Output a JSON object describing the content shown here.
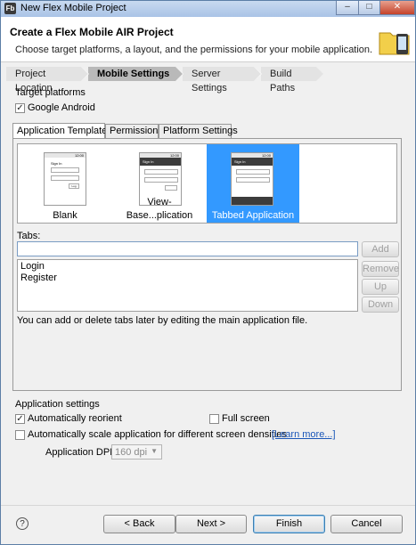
{
  "window": {
    "title": "New Flex Mobile Project",
    "app_icon": "Fb",
    "buttons": {
      "minimize": "–",
      "maximize": "□",
      "close": "✕"
    }
  },
  "header": {
    "title": "Create a Flex Mobile AIR Project",
    "subtitle": "Choose target platforms, a layout, and the permissions for your mobile application."
  },
  "steps": [
    {
      "label": "Project Location"
    },
    {
      "label": "Mobile Settings"
    },
    {
      "label": "Server Settings"
    },
    {
      "label": "Build Paths"
    }
  ],
  "target_platforms": {
    "label": "Target platforms",
    "google_android": {
      "label": "Google Android",
      "checked": "✓"
    }
  },
  "tabs": [
    {
      "label": "Application Template"
    },
    {
      "label": "Permissions"
    },
    {
      "label": "Platform Settings"
    }
  ],
  "templates": [
    {
      "label": "Blank"
    },
    {
      "label": "View-Base...plication"
    },
    {
      "label": "Tabbed Application"
    }
  ],
  "phone_ui": {
    "status": "12:00",
    "header": "Sign In",
    "button": "Log"
  },
  "tabs_section": {
    "label": "Tabs:",
    "input_value": "",
    "items": [
      "Login",
      "Register"
    ],
    "add": "Add",
    "remove": "Remove",
    "up": "Up",
    "down": "Down",
    "hint": "You can add or delete tabs later by editing the main application file."
  },
  "app_settings": {
    "label": "Application settings",
    "auto_reorient": {
      "label": "Automatically reorient",
      "checked": "✓"
    },
    "full_screen": {
      "label": "Full screen"
    },
    "auto_scale": {
      "label": "Automatically scale application for different screen densities"
    },
    "learn_more": "[Learn more...]",
    "dpi_label": "Application DPI:",
    "dpi_value": "160 dpi"
  },
  "footer": {
    "help": "?",
    "back": "< Back",
    "next": "Next >",
    "finish": "Finish",
    "cancel": "Cancel"
  }
}
